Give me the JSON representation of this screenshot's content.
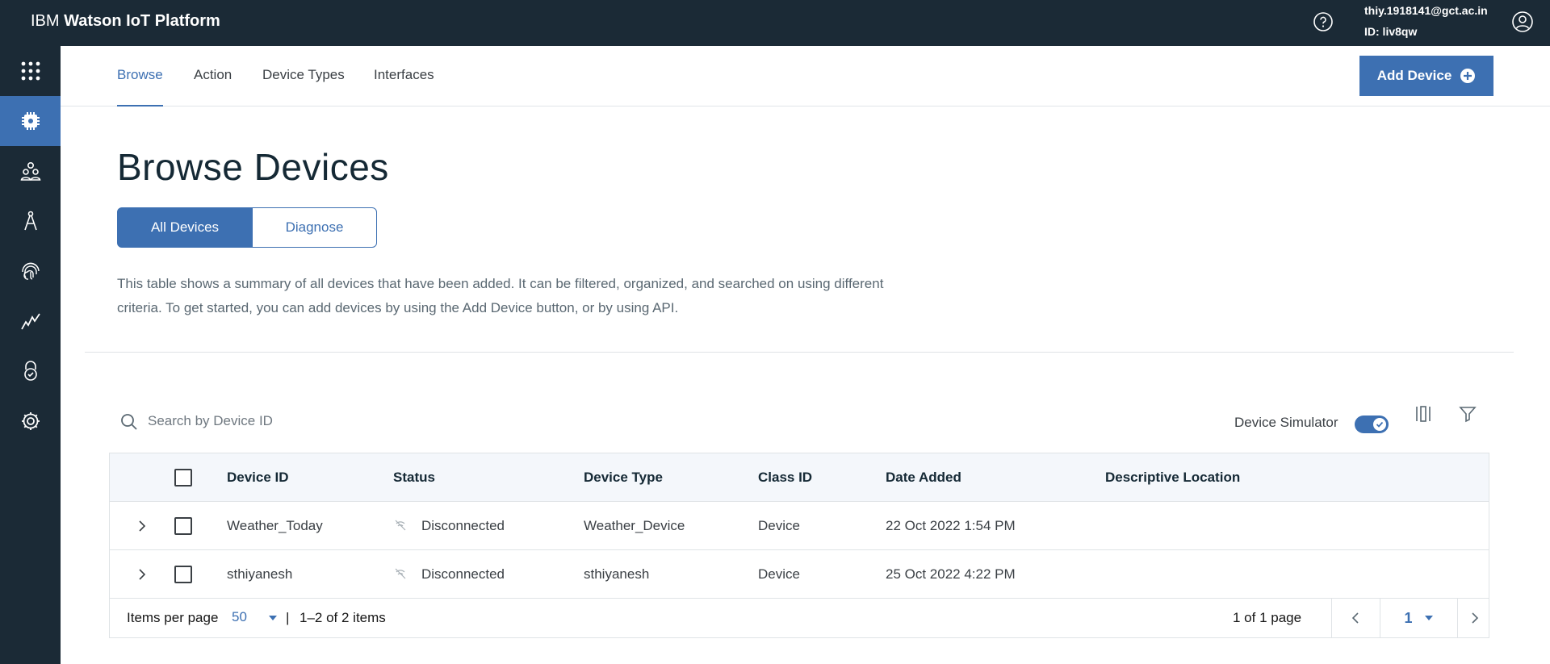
{
  "app": {
    "brand_prefix": "IBM",
    "brand_name": "Watson IoT Platform",
    "user_email": "thiy.1918141@gct.ac.in",
    "user_id": "ID: liv8qw",
    "accent_color": "#3d70b2",
    "header_color": "#1b2a36"
  },
  "sidebar": {
    "items": [
      {
        "icon": "apps-grid-icon"
      },
      {
        "icon": "devices-chip-icon",
        "active": true
      },
      {
        "icon": "members-icon"
      },
      {
        "icon": "apps-compass-icon"
      },
      {
        "icon": "fingerprint-icon"
      },
      {
        "icon": "usage-chart-icon"
      },
      {
        "icon": "security-lock-icon"
      },
      {
        "icon": "settings-gear-icon"
      }
    ]
  },
  "tabs": [
    {
      "label": "Browse",
      "active": true
    },
    {
      "label": "Action"
    },
    {
      "label": "Device Types"
    },
    {
      "label": "Interfaces"
    }
  ],
  "add_device_label": "Add Device",
  "page_title": "Browse Devices",
  "segments": {
    "all": "All Devices",
    "diagnose": "Diagnose",
    "selected": "All Devices"
  },
  "description": "This table shows a summary of all devices that have been added. It can be filtered, organized, and searched on using different criteria. To get started, you can add devices by using the Add Device button, or by using API.",
  "search": {
    "placeholder": "Search by Device ID",
    "value": ""
  },
  "simulator": {
    "label": "Device Simulator",
    "enabled": true
  },
  "table": {
    "headers": {
      "device_id": "Device ID",
      "status": "Status",
      "device_type": "Device Type",
      "class_id": "Class ID",
      "date_added": "Date Added",
      "location": "Descriptive Location"
    },
    "rows": [
      {
        "device_id": "Weather_Today",
        "status": "Disconnected",
        "device_type": "Weather_Device",
        "class_id": "Device",
        "date_added": "22 Oct 2022 1:54 PM",
        "location": ""
      },
      {
        "device_id": "sthiyanesh",
        "status": "Disconnected",
        "device_type": "sthiyanesh",
        "class_id": "Device",
        "date_added": "25 Oct 2022 4:22 PM",
        "location": ""
      }
    ]
  },
  "pagination": {
    "items_per_page_label": "Items per page",
    "items_per_page": "50",
    "separator": "|",
    "range": "1–2 of 2 items",
    "pages": "1 of 1 page",
    "current_page": "1"
  }
}
